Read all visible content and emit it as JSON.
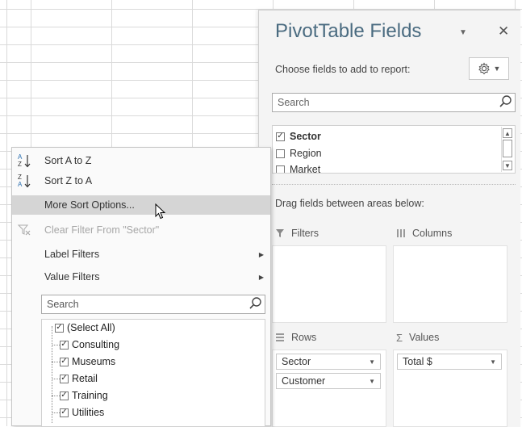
{
  "pivot_pane": {
    "title": "PivotTable Fields",
    "subtitle": "Choose fields to add to report:",
    "search_placeholder": "Search",
    "fields": [
      {
        "label": "Sector",
        "checked": true
      },
      {
        "label": "Region",
        "checked": false
      },
      {
        "label": "Market",
        "checked": false
      }
    ],
    "drag_label": "Drag fields between areas below:",
    "areas": {
      "filters": {
        "label": "Filters",
        "items": []
      },
      "columns": {
        "label": "Columns",
        "items": []
      },
      "rows": {
        "label": "Rows",
        "items": [
          "Sector",
          "Customer"
        ]
      },
      "values": {
        "label": "Values",
        "items": [
          "Total $"
        ]
      }
    },
    "icons": {
      "close": "close-icon",
      "gear": "gear-icon",
      "dropdown": "chevron-down-icon"
    }
  },
  "context_menu": {
    "items": [
      {
        "label": "Sort A to Z",
        "icon": "sort-ascending-icon",
        "disabled": false,
        "submenu": false
      },
      {
        "label": "Sort Z to A",
        "icon": "sort-descending-icon",
        "disabled": false,
        "submenu": false
      },
      {
        "label": "More Sort Options...",
        "icon": "",
        "disabled": false,
        "submenu": false,
        "highlighted": true
      },
      {
        "label": "Clear Filter From \"Sector\"",
        "icon": "clear-filter-icon",
        "disabled": true,
        "submenu": false
      },
      {
        "label": "Label Filters",
        "icon": "",
        "disabled": false,
        "submenu": true
      },
      {
        "label": "Value Filters",
        "icon": "",
        "disabled": false,
        "submenu": true
      }
    ],
    "search_placeholder": "Search",
    "filter_values": [
      {
        "label": "(Select All)",
        "checked": true
      },
      {
        "label": "Consulting",
        "checked": true
      },
      {
        "label": "Museums",
        "checked": true
      },
      {
        "label": "Retail",
        "checked": true
      },
      {
        "label": "Training",
        "checked": true
      },
      {
        "label": "Utilities",
        "checked": true
      }
    ]
  },
  "colors": {
    "title": "#4a6b80",
    "highlight": "#d5d5d5",
    "pane_bg": "#f4f4f4"
  }
}
